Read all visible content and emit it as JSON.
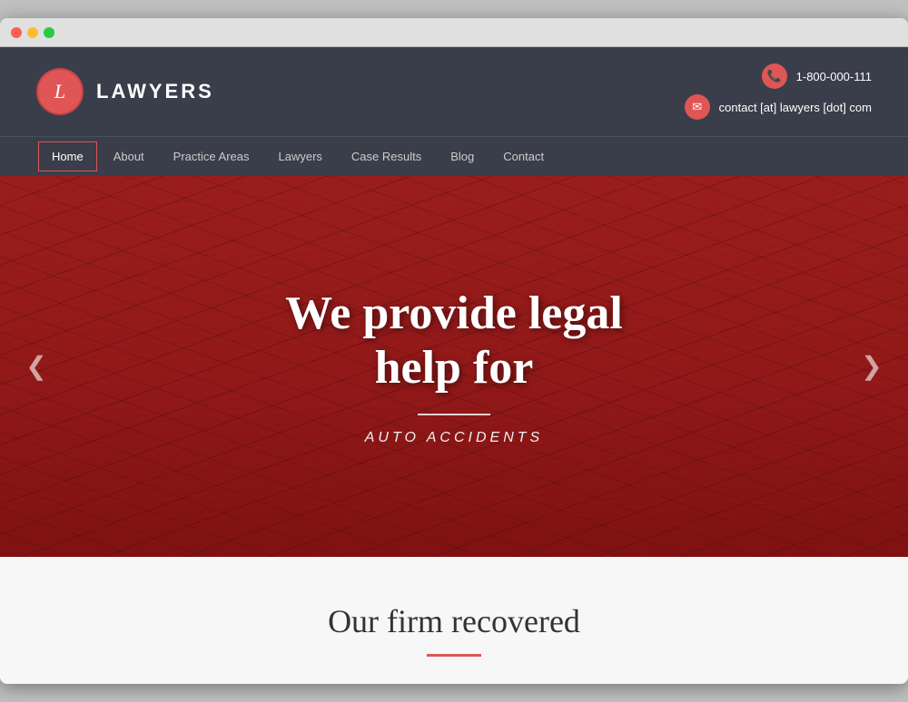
{
  "browser": {
    "dots": [
      "red",
      "yellow",
      "green"
    ]
  },
  "header": {
    "logo_letter": "L",
    "logo_name": "LAWYERS",
    "phone": "1-800-000-111",
    "email": "contact [at] lawyers [dot] com"
  },
  "nav": {
    "items": [
      {
        "label": "Home",
        "active": true
      },
      {
        "label": "About",
        "active": false
      },
      {
        "label": "Practice Areas",
        "active": false
      },
      {
        "label": "Lawyers",
        "active": false
      },
      {
        "label": "Case Results",
        "active": false
      },
      {
        "label": "Blog",
        "active": false
      },
      {
        "label": "Contact",
        "active": false
      }
    ]
  },
  "hero": {
    "main_text_line1": "We provide legal",
    "main_text_line2": "help for",
    "subtitle": "AUTO ACCIDENTS",
    "arrow_left": "❮",
    "arrow_right": "❯"
  },
  "below_hero": {
    "title": "Our firm recovered"
  }
}
